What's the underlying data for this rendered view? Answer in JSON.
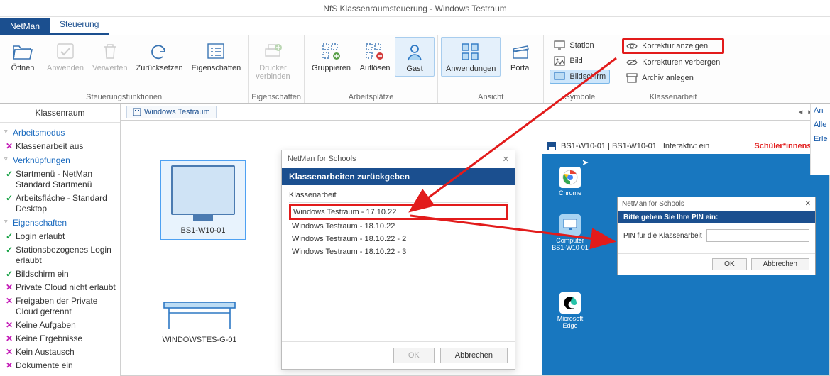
{
  "window_title": "NfS Klassenraumsteuerung - Windows Testraum",
  "tabs": {
    "netman": "NetMan",
    "steuerung": "Steuerung"
  },
  "ribbon": {
    "oeffnen": "Öffnen",
    "anwenden": "Anwenden",
    "verwerfen": "Verwerfen",
    "zuruecksetzen": "Zurücksetzen",
    "eigenschaften": "Eigenschaften",
    "group1": "Steuerungsfunktionen",
    "drucker": "Drucker\nverbinden",
    "group2": "Eigenschaften",
    "gruppieren": "Gruppieren",
    "aufloesen": "Auflösen",
    "gast": "Gast",
    "group3": "Arbeitsplätze",
    "anwendungen": "Anwendungen",
    "portal": "Portal",
    "group4": "Ansicht",
    "station": "Station",
    "bild": "Bild",
    "bildschirm": "Bildschirm",
    "group5": "Symbole",
    "korrektur_anzeigen": "Korrektur anzeigen",
    "korrekturen_verbergen": "Korrekturen verbergen",
    "archiv_anlegen": "Archiv anlegen",
    "group6": "Klassenarbeit"
  },
  "side": {
    "title": "Klassenraum",
    "groups": [
      {
        "title": "Arbeitsmodus",
        "items": [
          {
            "state": "no",
            "label": "Klassenarbeit aus"
          }
        ]
      },
      {
        "title": "Verknüpfungen",
        "items": [
          {
            "state": "ok",
            "label": "Startmenü - NetMan Standard Startmenü"
          },
          {
            "state": "ok",
            "label": "Arbeitsfläche - Standard Desktop"
          }
        ]
      },
      {
        "title": "Eigenschaften",
        "items": [
          {
            "state": "ok",
            "label": "Login erlaubt"
          },
          {
            "state": "ok",
            "label": "Stationsbezogenes Login erlaubt"
          },
          {
            "state": "ok",
            "label": "Bildschirm ein"
          },
          {
            "state": "no",
            "label": "Private Cloud nicht erlaubt"
          },
          {
            "state": "no",
            "label": "Freigaben der Private Cloud getrennt"
          },
          {
            "state": "no",
            "label": "Keine Aufgaben"
          },
          {
            "state": "no",
            "label": "Keine Ergebnisse"
          },
          {
            "state": "no",
            "label": "Kein Austausch"
          },
          {
            "state": "no",
            "label": "Dokumente ein"
          }
        ]
      }
    ]
  },
  "doc_tab": "Windows Testraum",
  "devices": {
    "ws": "BS1-W10-01",
    "desk": "WINDOWSTES-G-01"
  },
  "dialog": {
    "frame_title": "NetMan for Schools",
    "header": "Klassenarbeiten zurückgeben",
    "col": "Klassenarbeit",
    "items": [
      "Windows Testraum - 17.10.22",
      "Windows Testraum - 18.10.22",
      "Windows Testraum - 18.10.22 - 2",
      "Windows Testraum - 18.10.22 - 3"
    ],
    "ok": "OK",
    "cancel": "Abbrechen"
  },
  "student": {
    "header": "BS1-W10-01 | BS1-W10-01 | Interaktiv: ein",
    "tag": "Schüler*innensicht",
    "icons": {
      "chrome": "Chrome",
      "computer": "Computer\nBS1-W10-01",
      "edge": "Microsoft Edge"
    },
    "pin": {
      "frame_title": "NetMan for Schools",
      "header": "Bitte geben Sie Ihre PIN ein:",
      "label": "PIN für die Klassenarbeit",
      "ok": "OK",
      "cancel": "Abbrechen"
    }
  },
  "right_panel": {
    "an": "An",
    "alle": "Alle",
    "erle": "Erle"
  }
}
